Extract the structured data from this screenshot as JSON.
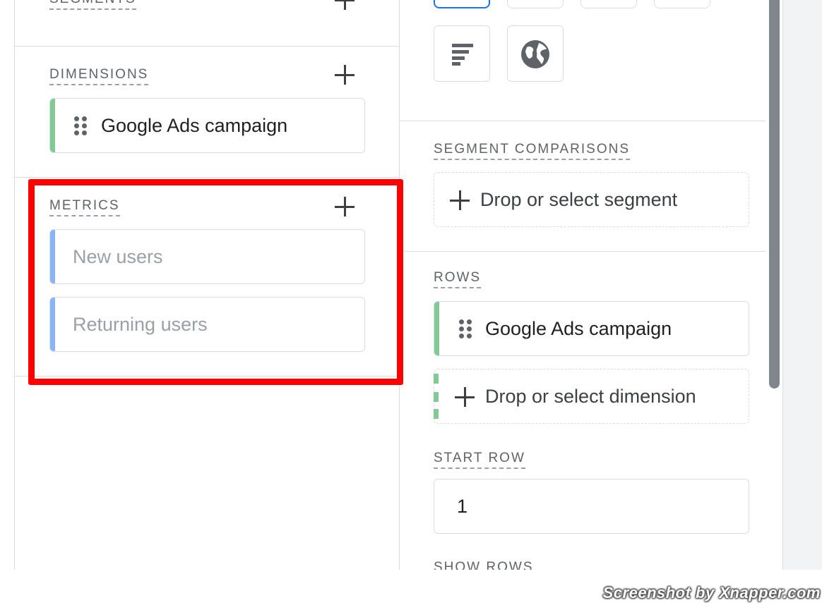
{
  "left_panel": {
    "segments": {
      "label": "SEGMENTS"
    },
    "dimensions": {
      "label": "DIMENSIONS",
      "items": [
        {
          "label": "Google Ads campaign",
          "color": "#81c995"
        }
      ]
    },
    "metrics": {
      "label": "METRICS",
      "items": [
        {
          "label": "New users",
          "color": "#8ab4f8"
        },
        {
          "label": "Returning users",
          "color": "#8ab4f8"
        }
      ]
    }
  },
  "right_panel": {
    "visualization": {
      "icons": [
        "bar-chart-horizontal-icon",
        "globe-icon"
      ],
      "selected_color": "#1a73e8"
    },
    "segment_comparisons": {
      "label": "SEGMENT COMPARISONS",
      "dropzone_text": "Drop or select segment"
    },
    "rows": {
      "label": "ROWS",
      "items": [
        {
          "label": "Google Ads campaign",
          "color": "#81c995"
        }
      ],
      "dropzone_text": "Drop or select dimension"
    },
    "start_row": {
      "label": "START ROW",
      "value": "1"
    },
    "show_rows": {
      "label": "SHOW ROWS"
    }
  },
  "highlight_color": "#ff0000",
  "watermark": "Screenshot by Xnapper.com"
}
